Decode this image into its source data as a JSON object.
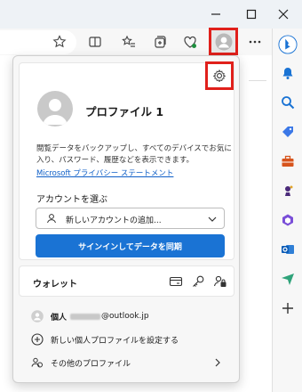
{
  "profile": {
    "name": "プロファイル 1",
    "description": "閲覧データをバックアップし、すべてのデバイスでお気に入り、パスワード、履歴などを表示できます。",
    "privacy_link": "Microsoft プライバシー ステートメント",
    "choose_account_label": "アカウントを選ぶ",
    "account_select_value": "新しいアカウントの追加...",
    "sync_button": "サインインしてデータを同期"
  },
  "wallet": {
    "label": "ウォレット"
  },
  "personal_profile": {
    "type_label": "個人",
    "email_suffix": "@outlook.jp"
  },
  "menu": {
    "add_profile": "新しい個人プロファイルを設定する",
    "other_profiles": "その他のプロファイル"
  },
  "colors": {
    "accent": "#1a73d4",
    "highlight": "#e0201b",
    "link": "#0f5fc7"
  }
}
